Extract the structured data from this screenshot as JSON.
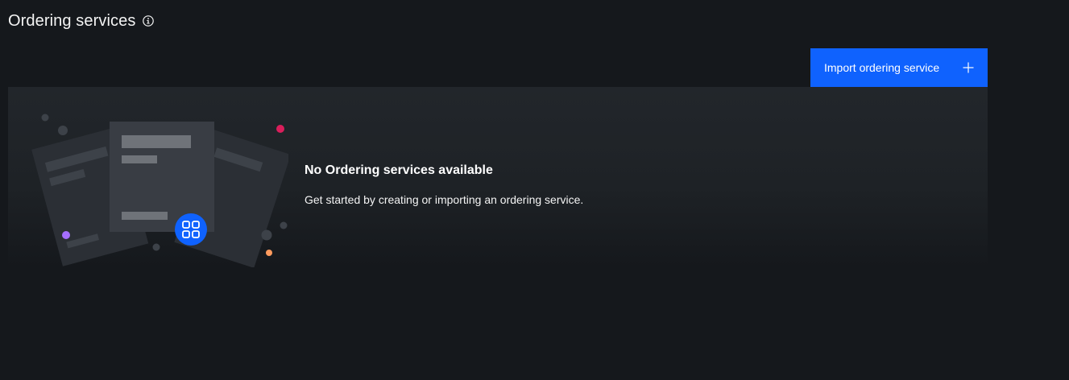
{
  "header": {
    "title": "Ordering services",
    "info_icon": "info-icon"
  },
  "toolbar": {
    "import_label": "Import ordering service",
    "import_icon": "plus-icon",
    "button_color": "#0f62fe"
  },
  "empty_state": {
    "title": "No Ordering services available",
    "description": "Get started by creating or importing an ordering service.",
    "illustration_icon": "grid-app-icon"
  },
  "colors": {
    "background": "#15181c",
    "panel": "#22262b",
    "accent_blue": "#0f62fe",
    "dot_pink": "#da1e5b",
    "dot_purple": "#a56eff",
    "dot_orange": "#ff9b5e"
  }
}
